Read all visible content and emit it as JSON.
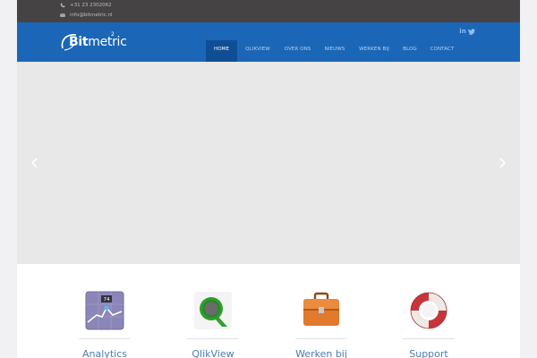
{
  "topbar": {
    "phone": "+31 23 2302062",
    "email": "info@bitmetric.nl"
  },
  "brand": {
    "logo_bold": "Bit",
    "logo_light": "metric",
    "logo_superscript": "2"
  },
  "social": {
    "items": [
      {
        "icon": "linkedin-icon",
        "text": "in"
      },
      {
        "icon": "twitter-icon"
      }
    ]
  },
  "nav": {
    "items": [
      {
        "label": "HOME",
        "active": true
      },
      {
        "label": "QLIKVIEW"
      },
      {
        "label": "OVER ONS"
      },
      {
        "label": "NIEUWS"
      },
      {
        "label": "WERKEN BIJ"
      },
      {
        "label": "BLOG"
      },
      {
        "label": "CONTACT"
      }
    ]
  },
  "slider": {
    "prev_icon": "chevron-left-icon",
    "next_icon": "chevron-right-icon"
  },
  "features": [
    {
      "label": "Analytics",
      "icon": "analytics-chart-icon",
      "badge": "74"
    },
    {
      "label": "QlikView",
      "icon": "qlikview-icon"
    },
    {
      "label": "Werken bij",
      "icon": "briefcase-icon"
    },
    {
      "label": "Support",
      "icon": "lifebuoy-icon"
    }
  ],
  "colors": {
    "topbar": "#464344",
    "navbar": "#1b66b7",
    "nav_active": "#0f4e95",
    "slider": "#e8e8e8",
    "feature_label": "#4a7cb0",
    "page_bg": "#f1f1f4"
  }
}
